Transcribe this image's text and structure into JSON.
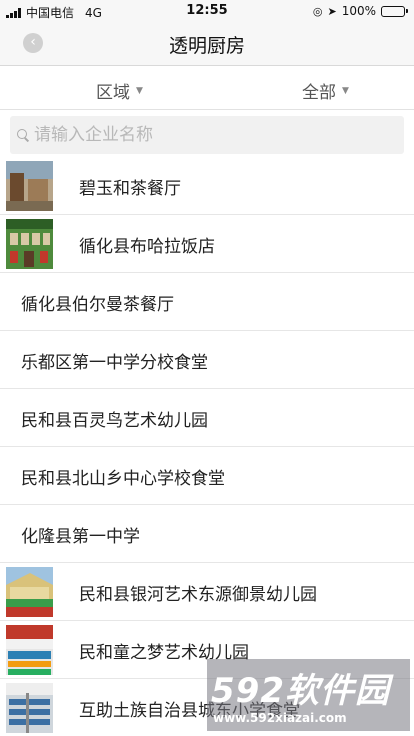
{
  "status_bar": {
    "carrier": "中国电信",
    "network": "4G",
    "time": "12:55",
    "battery_percent": "100%",
    "battery_level": 1.0,
    "battery_color": "#2ecc40"
  },
  "nav": {
    "title": "透明厨房",
    "back_icon": "chevron-left-icon"
  },
  "filters": {
    "area_label": "区域",
    "all_label": "全部"
  },
  "search": {
    "placeholder": "请输入企业名称",
    "value": ""
  },
  "list": {
    "items": [
      {
        "name": "碧玉和茶餐厅",
        "has_thumbnail": true
      },
      {
        "name": "循化县布哈拉饭店",
        "has_thumbnail": true
      },
      {
        "name": "循化县伯尔曼茶餐厅",
        "has_thumbnail": false
      },
      {
        "name": "乐都区第一中学分校食堂",
        "has_thumbnail": false
      },
      {
        "name": "民和县百灵鸟艺术幼儿园",
        "has_thumbnail": false
      },
      {
        "name": "民和县北山乡中心学校食堂",
        "has_thumbnail": false
      },
      {
        "name": "化隆县第一中学",
        "has_thumbnail": false
      },
      {
        "name": "民和县银河艺术东源御景幼儿园",
        "has_thumbnail": true
      },
      {
        "name": "民和童之梦艺术幼儿园",
        "has_thumbnail": true
      },
      {
        "name": "互助土族自治县城东小学食堂",
        "has_thumbnail": true
      }
    ]
  },
  "watermark": {
    "logo": "592软件园",
    "url": "www.592xiazai.com"
  }
}
